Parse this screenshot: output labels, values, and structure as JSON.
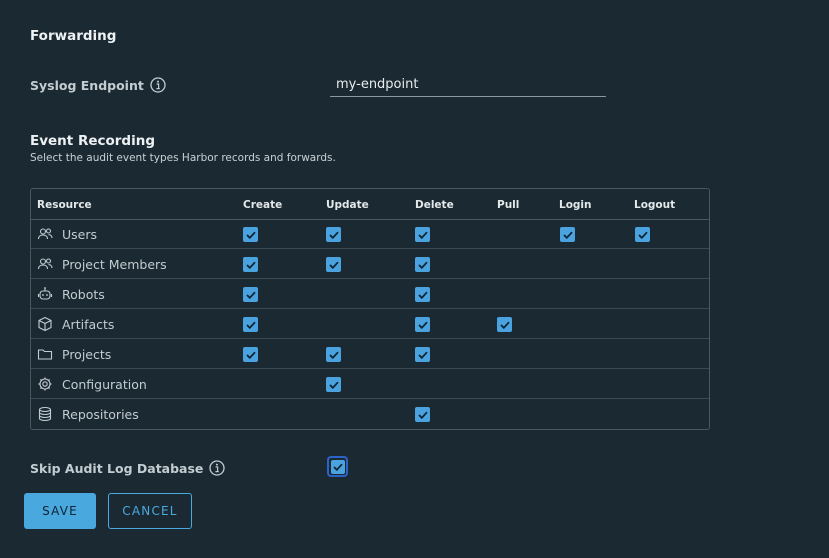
{
  "forwarding": {
    "heading": "Forwarding",
    "syslog_label": "Syslog Endpoint",
    "syslog_value": "my-endpoint"
  },
  "event_recording": {
    "heading": "Event Recording",
    "subtitle": "Select the audit event types Harbor records and forwards.",
    "columns": [
      "Resource",
      "Create",
      "Update",
      "Delete",
      "Pull",
      "Login",
      "Logout"
    ],
    "rows": [
      {
        "icon": "users-icon",
        "name": "Users",
        "checks": [
          true,
          true,
          true,
          false,
          true,
          true
        ]
      },
      {
        "icon": "project-members-icon",
        "name": "Project Members",
        "checks": [
          true,
          true,
          true,
          false,
          false,
          false
        ]
      },
      {
        "icon": "robot-icon",
        "name": "Robots",
        "checks": [
          true,
          false,
          true,
          false,
          false,
          false
        ]
      },
      {
        "icon": "artifact-box-icon",
        "name": "Artifacts",
        "checks": [
          true,
          false,
          true,
          true,
          false,
          false
        ]
      },
      {
        "icon": "folder-icon",
        "name": "Projects",
        "checks": [
          true,
          true,
          true,
          false,
          false,
          false
        ]
      },
      {
        "icon": "gear-icon",
        "name": "Configuration",
        "checks": [
          false,
          true,
          false,
          false,
          false,
          false
        ]
      },
      {
        "icon": "database-icon",
        "name": "Repositories",
        "checks": [
          false,
          false,
          true,
          false,
          false,
          false
        ]
      }
    ]
  },
  "skip_audit": {
    "label": "Skip Audit Log Database",
    "checked": true
  },
  "buttons": {
    "save": "SAVE",
    "cancel": "CANCEL"
  },
  "colors": {
    "background": "#1b2a32",
    "accent": "#4aa3df",
    "focus_ring": "#2c63c9"
  }
}
